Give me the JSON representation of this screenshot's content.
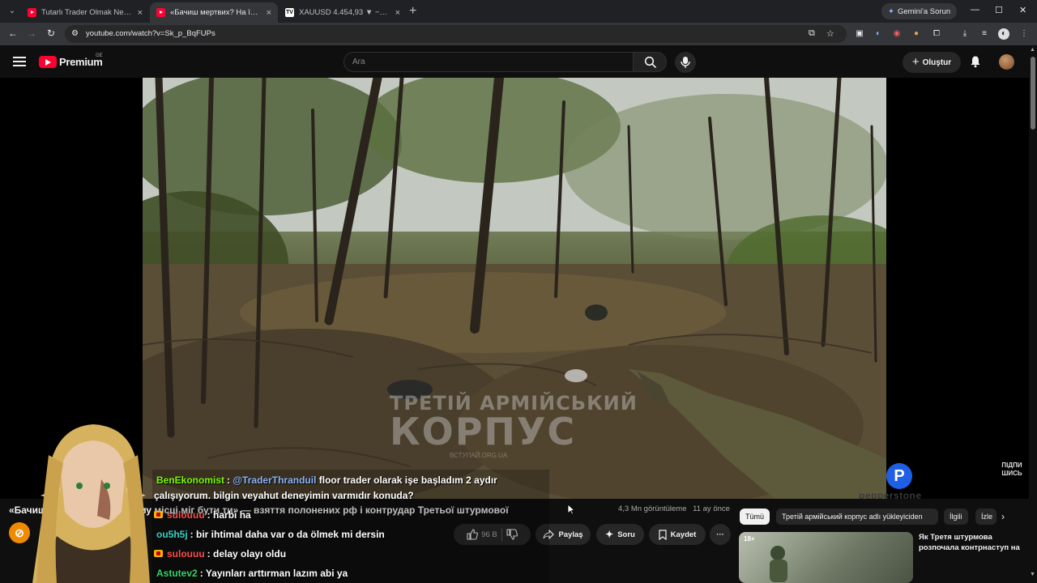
{
  "browser": {
    "tabs": [
      {
        "title": "Tutarlı Trader Olmak Nedir ? Dü",
        "favicon": "youtube-icon",
        "active": false
      },
      {
        "title": "«Бачиш мертвих? На їхньому",
        "favicon": "youtube-icon",
        "active": true
      },
      {
        "title": "XAUUSD 4.454,93 ▼ −3,19% Al",
        "favicon": "tradingview-icon",
        "active": false
      }
    ],
    "new_tab_symbol": "+",
    "tab_close_symbol": "×",
    "gemini_button": "Gemini'a Sorun",
    "url": "youtube.com/watch?v=Sk_p_BqFUPs",
    "window_controls": {
      "minimize": "—",
      "maximize": "☐",
      "close": "✕"
    }
  },
  "youtube": {
    "brand": "Premium",
    "country_code": "GE",
    "search_placeholder": "Ara",
    "create_label": "Oluştur"
  },
  "video": {
    "watermark_line1": "ТРЕТІЙ АРМІЙСЬКИЙ",
    "watermark_line2": "КОРПУС",
    "watermark_line3": "ВСТУПАЙ.ORG.UA",
    "corner_logo": "ПІДПИ ШИСЬ",
    "ad_brand": "pepperstone",
    "title": "«Бачиш мертвих? На їхньому місці міг бути ти» — взяття полонених рф і контрудар Третьої штурмової",
    "views": "4,3 Mn görüntüleme",
    "date": "11 ay önce"
  },
  "actions": {
    "like_count": "96 B",
    "share": "Paylaş",
    "ask": "Soru",
    "save": "Kaydet",
    "more": "···"
  },
  "chips": [
    {
      "label": "Tümü",
      "active": true
    },
    {
      "label": "Третій армійський корпус adlı yükleyiciden",
      "active": false
    },
    {
      "label": "İlgili",
      "active": false
    },
    {
      "label": "İzle",
      "active": false
    }
  ],
  "recommendation": {
    "badge": "18+",
    "title": "Як Третя штурмова розпочала контрнаступ на"
  },
  "chat": [
    {
      "user": "BenEkonomist",
      "user_color": "#7CFC00",
      "badge": false,
      "text": "@TraderThranduil floor trader olarak işe başladım 2 aydır"
    },
    {
      "user": "",
      "user_color": "#ffffff",
      "badge": false,
      "text": "çalışıyorum. bilgin veyahut deneyimin varmıdır konuda?"
    },
    {
      "user": "sulouuu",
      "user_color": "#ff4d4d",
      "badge": true,
      "text": "harbi ha"
    },
    {
      "user": "ou5h5j",
      "user_color": "#35d4c8",
      "badge": false,
      "text": "bir ihtimal daha var o da ölmek mi dersin"
    },
    {
      "user": "sulouuu",
      "user_color": "#ff4d4d",
      "badge": true,
      "text": "delay olayı oldu"
    },
    {
      "user": "Astutev2",
      "user_color": "#35d46a",
      "badge": false,
      "text": "Yayınları arttırman lazım abi ya"
    }
  ],
  "mention": "@TraderThranduil",
  "mention_color": "#8ab4f8"
}
